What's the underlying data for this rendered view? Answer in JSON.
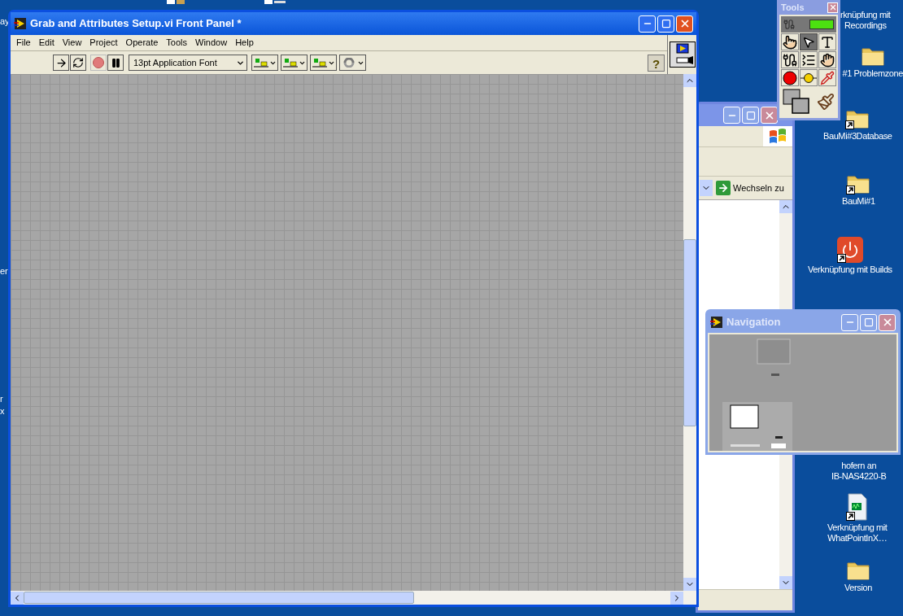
{
  "desktop": {
    "edge_labels": [
      "ay",
      "er",
      "r",
      "x"
    ],
    "icons": [
      {
        "kind": "text_only",
        "lines": [
          "rknüpfung mit",
          "Recordings"
        ]
      },
      {
        "kind": "folder",
        "lines": [
          "#1 Problemzone"
        ]
      },
      {
        "kind": "folder_shortcut",
        "lines": [
          "BauMi#3Database"
        ]
      },
      {
        "kind": "folder_shortcut",
        "lines": [
          "BauMi#1"
        ]
      },
      {
        "kind": "power_shortcut",
        "lines": [
          "Verknüpfung mit Builds"
        ]
      },
      {
        "kind": "text_only",
        "lines": [
          "hofern an",
          "IB-NAS4220-B"
        ]
      },
      {
        "kind": "vi_shortcut",
        "lines": [
          "Verknüpfung mit",
          "WhatPointInX…"
        ]
      },
      {
        "kind": "folder",
        "lines": [
          "Version"
        ]
      }
    ]
  },
  "main_window": {
    "title": "Grab and Attributes Setup.vi Front Panel *",
    "menu": [
      "File",
      "Edit",
      "View",
      "Project",
      "Operate",
      "Tools",
      "Window",
      "Help"
    ],
    "font_dropdown": "13pt Application Font",
    "help_button": "?"
  },
  "explorer_window": {
    "go_button": "Wechseln zu"
  },
  "tools_palette": {
    "title": "Tools",
    "auto_tool_on": true,
    "tools": [
      {
        "kind": "operate",
        "selected": false
      },
      {
        "kind": "position",
        "selected": true
      },
      {
        "kind": "text",
        "selected": false
      },
      {
        "kind": "wire",
        "selected": false
      },
      {
        "kind": "shortcut",
        "selected": false
      },
      {
        "kind": "scroll",
        "selected": false
      },
      {
        "kind": "breakpoint",
        "selected": false
      },
      {
        "kind": "probe",
        "selected": false
      },
      {
        "kind": "color_copy",
        "selected": false
      }
    ]
  },
  "navigation_window": {
    "title": "Navigation"
  }
}
